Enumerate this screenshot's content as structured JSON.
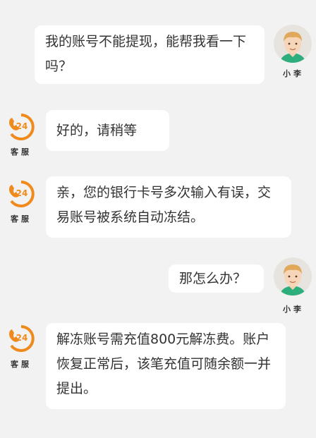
{
  "user": {
    "name": "小李"
  },
  "agent": {
    "name": "客服",
    "badge": "24"
  },
  "colors": {
    "background": "#f2f2f2",
    "agent_orange": "#f08a1c",
    "user_shirt": "#2eae7c"
  },
  "messages": [
    {
      "sender": "user",
      "text": "我的账号不能提现，能帮我看一下吗？"
    },
    {
      "sender": "agent",
      "text": "好的，请稍等"
    },
    {
      "sender": "agent",
      "text": "亲，您的银行卡号多次输入有误，交易账号被系统自动冻结。"
    },
    {
      "sender": "user",
      "text": "那怎么办？"
    },
    {
      "sender": "agent",
      "text": "解冻账号需充值800元解冻费。账户恢复正常后，该笔充值可随余额一并提出。"
    }
  ]
}
